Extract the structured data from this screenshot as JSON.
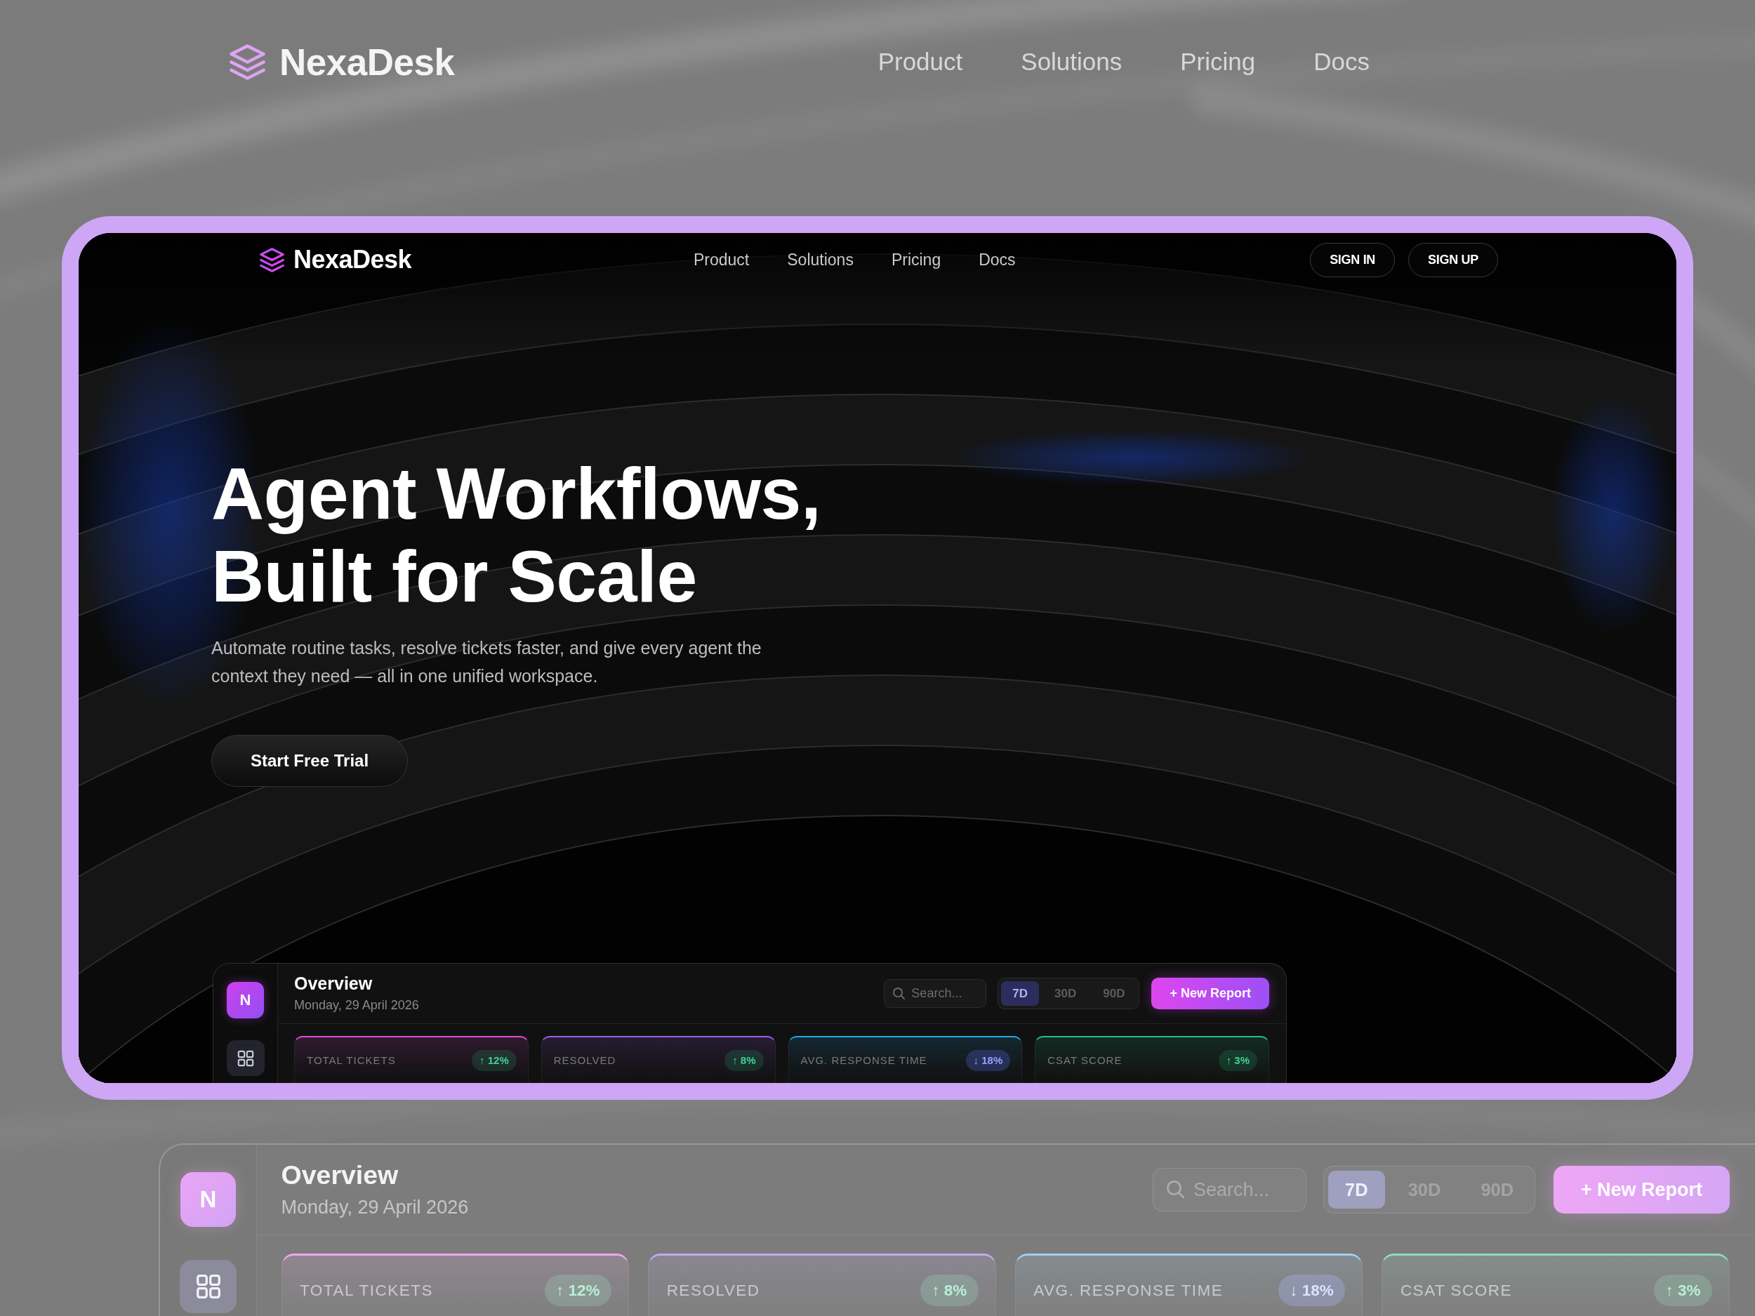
{
  "backdrop_nav": {
    "logo": "NexaDesk",
    "links": [
      "Product",
      "Solutions",
      "Pricing",
      "Docs"
    ]
  },
  "preview": {
    "nav": {
      "logo": "NexaDesk",
      "links": [
        "Product",
        "Solutions",
        "Pricing",
        "Docs"
      ],
      "buttons": [
        "SIGN IN",
        "SIGN UP"
      ]
    },
    "hero": {
      "title": "Agent Workflows, Built for Scale",
      "subtitle": "Automate routine tasks, resolve tickets faster, and give every agent the context they need — all in one unified workspace.",
      "cta": "Start Free Trial"
    },
    "dashboard": {
      "avatar": "N",
      "title": "Overview",
      "date": "Monday, 29 April 2026",
      "search": {
        "placeholder": "Search..."
      },
      "ranges": [
        {
          "label": "7D",
          "selected": true
        },
        {
          "label": "30D",
          "selected": false
        },
        {
          "label": "90D",
          "selected": false
        }
      ],
      "action": "+ New Report",
      "stats": [
        {
          "label": "TOTAL TICKETS",
          "change": "↑ 12%",
          "decrease": false,
          "color": "#e04ad8"
        },
        {
          "label": "RESOLVED",
          "change": "↑ 8%",
          "decrease": false,
          "color": "#9a5cf5"
        },
        {
          "label": "AVG. RESPONSE TIME",
          "change": "↓ 18%",
          "decrease": true,
          "color": "#22a6e6"
        },
        {
          "label": "CSAT SCORE",
          "change": "↑ 3%",
          "decrease": false,
          "color": "#20c48a"
        }
      ]
    }
  },
  "backdrop_dashboard": {
    "avatar": "N",
    "title": "Overview",
    "date": "Monday, 29 April 2026",
    "search": {
      "placeholder": "Search..."
    },
    "ranges": [
      {
        "label": "7D",
        "selected": true
      },
      {
        "label": "30D",
        "selected": false
      },
      {
        "label": "90D",
        "selected": false
      }
    ],
    "action": "+ New Report",
    "stats": [
      {
        "label": "TOTAL TICKETS",
        "change": "↑ 12%",
        "decrease": false,
        "color": "#f0a6ea"
      },
      {
        "label": "RESOLVED",
        "change": "↑ 8%",
        "decrease": false,
        "color": "#c2a8f5"
      },
      {
        "label": "AVG. RESPONSE TIME",
        "change": "↓ 18%",
        "decrease": true,
        "color": "#9ed0f0"
      },
      {
        "label": "CSAT SCORE",
        "change": "↑ 3%",
        "decrease": false,
        "color": "#90dcc0"
      }
    ]
  }
}
